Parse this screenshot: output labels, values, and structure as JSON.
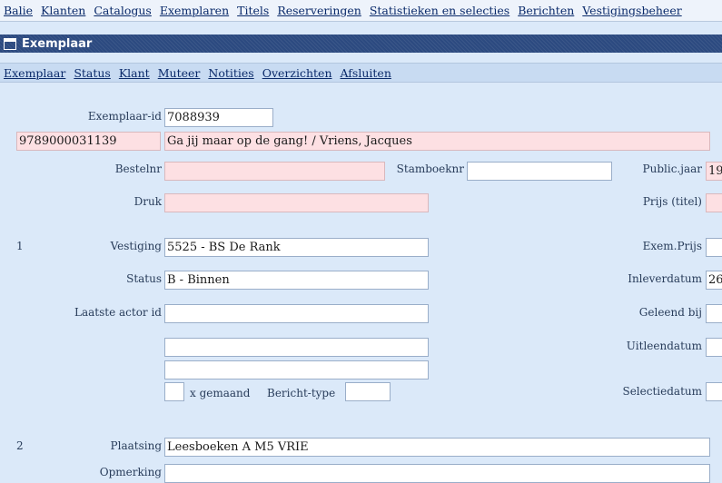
{
  "top_menu": [
    "Balie",
    "Klanten",
    "Catalogus",
    "Exemplaren",
    "Titels",
    "Reserveringen",
    "Statistieken en selecties",
    "Berichten",
    "Vestigingsbeheer"
  ],
  "window": {
    "title": "Exemplaar"
  },
  "sub_menu": [
    "Exemplaar",
    "Status",
    "Klant",
    "Muteer",
    "Notities",
    "Overzichten",
    "Afsluiten"
  ],
  "form": {
    "exemplaar_id": {
      "label": "Exemplaar-id",
      "value": "7088939"
    },
    "isbn": "9789000031139",
    "title_author": "Ga jij maar op de gang! / Vriens, Jacques",
    "bestelnr": {
      "label": "Bestelnr",
      "value": ""
    },
    "stamboeknr": {
      "label": "Stamboeknr",
      "value": ""
    },
    "publicjaar": {
      "label": "Public.jaar",
      "value": "19"
    },
    "druk": {
      "label": "Druk",
      "value": ""
    },
    "prijs_titel": {
      "label": "Prijs (titel)",
      "value": ""
    },
    "section1_num": "1",
    "vestiging": {
      "label": "Vestiging",
      "value": "5525 - BS De Rank"
    },
    "exem_prijs": {
      "label": "Exem.Prijs",
      "value": ""
    },
    "status": {
      "label": "Status",
      "value": "B - Binnen"
    },
    "inleverdatum": {
      "label": "Inleverdatum",
      "value": "26"
    },
    "laatste_actor": {
      "label": "Laatste actor id",
      "value": ""
    },
    "geleend_bij": {
      "label": "Geleend bij",
      "value": ""
    },
    "extra1": "",
    "extra2": "",
    "uitleendatum": {
      "label": "Uitleendatum",
      "value": ""
    },
    "gemaand": {
      "label": "x gemaand",
      "value": ""
    },
    "bericht_type": {
      "label": "Bericht-type",
      "value": ""
    },
    "selectiedatum": {
      "label": "Selectiedatum",
      "value": ""
    },
    "section2_num": "2",
    "plaatsing": {
      "label": "Plaatsing",
      "value": "Leesboeken A M5 VRIE"
    },
    "opmerking": {
      "label": "Opmerking",
      "value": ""
    }
  }
}
